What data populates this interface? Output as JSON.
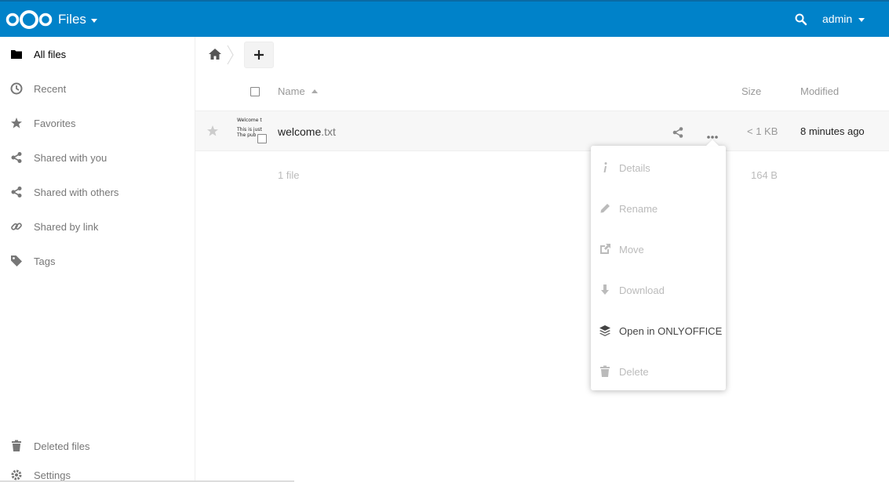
{
  "colors": {
    "brand": "#0082c9",
    "active_text": "#000000",
    "muted_text": "#777777",
    "disabled_text": "#bbbbbb"
  },
  "header": {
    "app_title": "Files",
    "user": "admin",
    "logo_icon": "nextcloud-logo-icon",
    "search_icon": "search-icon"
  },
  "sidebar": {
    "items": [
      {
        "label": "All files",
        "icon": "folder-icon",
        "active": true
      },
      {
        "label": "Recent",
        "icon": "clock-icon"
      },
      {
        "label": "Favorites",
        "icon": "star-icon"
      },
      {
        "label": "Shared with you",
        "icon": "share-icon"
      },
      {
        "label": "Shared with others",
        "icon": "share-icon"
      },
      {
        "label": "Shared by link",
        "icon": "link-icon"
      },
      {
        "label": "Tags",
        "icon": "tag-icon"
      }
    ],
    "deleted_label": "Deleted files",
    "settings_label": "Settings"
  },
  "table": {
    "col_name": "Name",
    "col_size": "Size",
    "col_modified": "Modified",
    "rows": [
      {
        "name_base": "welcome",
        "name_ext": ".txt",
        "size": "< 1 KB",
        "modified": "8 minutes ago",
        "thumb_line1": "Welcome t",
        "thumb_line2": "This is just",
        "thumb_line3": "The pub"
      }
    ],
    "summary_count": "1 file",
    "summary_size": "164 B"
  },
  "menu": {
    "items": [
      {
        "label": "Details",
        "icon": "info-icon"
      },
      {
        "label": "Rename",
        "icon": "pencil-icon"
      },
      {
        "label": "Move",
        "icon": "external-move-icon"
      },
      {
        "label": "Download",
        "icon": "download-arrow-icon"
      },
      {
        "label": "Open in ONLYOFFICE",
        "icon": "onlyoffice-layers-icon"
      },
      {
        "label": "Delete",
        "icon": "trash-icon"
      }
    ]
  }
}
